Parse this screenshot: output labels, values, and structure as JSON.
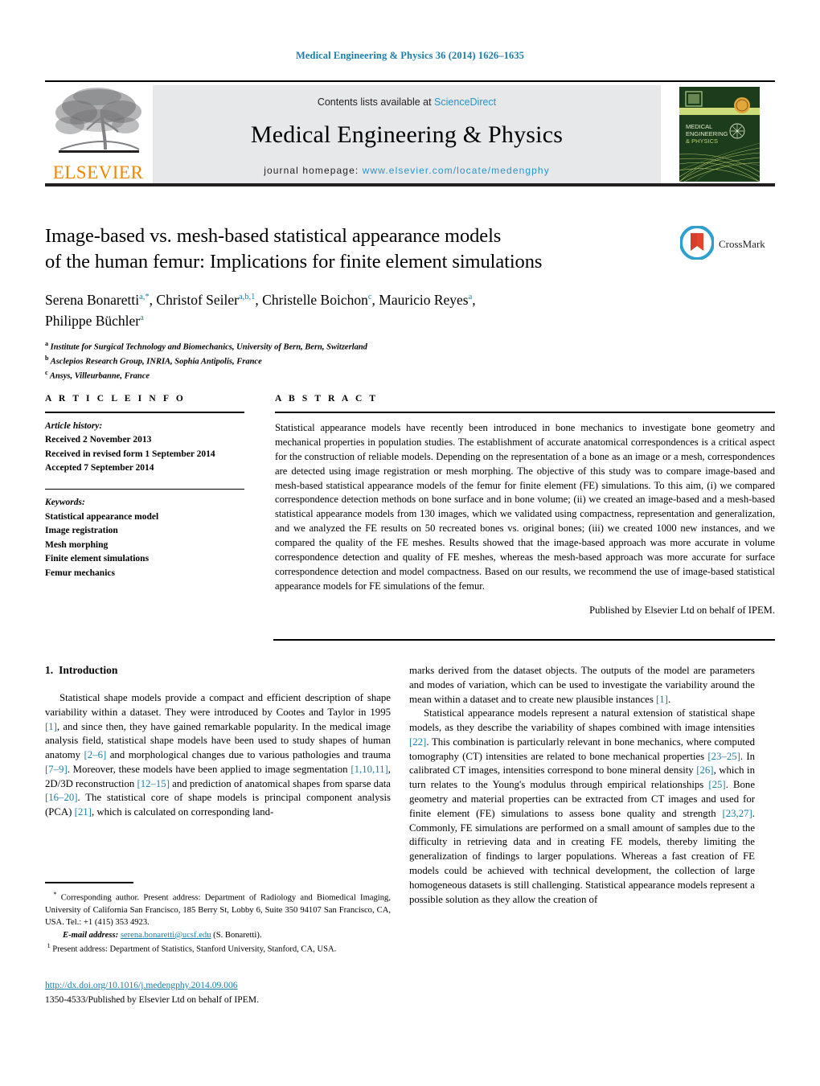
{
  "running_head": "Medical Engineering & Physics 36 (2014) 1626–1635",
  "masthead": {
    "contents_prefix": "Contents lists available at ",
    "sciencedirect": "ScienceDirect",
    "journal_title": "Medical Engineering & Physics",
    "homepage_prefix": "journal homepage: ",
    "homepage_url": "www.elsevier.com/locate/medengphy",
    "publisher_wordmark": "ELSEVIER",
    "cover_title_lines": [
      "MEDICAL",
      "ENGINEERING",
      "& PHYSICS"
    ],
    "accent_blue": "#2a93c9",
    "elsevier_orange": "#f08500",
    "band_gray": "#e7e8ea"
  },
  "crossmark": {
    "label": "CrossMark"
  },
  "article": {
    "title_line1": "Image-based vs. mesh-based statistical appearance models",
    "title_line2": "of the human femur: Implications for finite element simulations",
    "authors_line1_parts": [
      {
        "name": "Serena Bonaretti",
        "sup": "a,*"
      },
      {
        "name": "Christof Seiler",
        "sup": "a,b,1"
      },
      {
        "name": "Christelle Boichon",
        "sup": "c"
      },
      {
        "name": "Mauricio Reyes",
        "sup": "a"
      }
    ],
    "authors_line2_parts": [
      {
        "name": "Philippe Büchler",
        "sup": "a"
      }
    ],
    "affiliations": [
      {
        "mark": "a",
        "text": "Institute for Surgical Technology and Biomechanics, University of Bern, Bern, Switzerland"
      },
      {
        "mark": "b",
        "text": "Asclepios Research Group, INRIA, Sophia Antipolis, France"
      },
      {
        "mark": "c",
        "text": "Ansys, Villeurbanne, France"
      }
    ]
  },
  "article_info": {
    "heading": "A R T I C L E   I N F O",
    "history_label": "Article history:",
    "history": [
      "Received 2 November 2013",
      "Received in revised form 1 September 2014",
      "Accepted 7 September 2014"
    ],
    "keywords_label": "Keywords:",
    "keywords": [
      "Statistical appearance model",
      "Image registration",
      "Mesh morphing",
      "Finite element simulations",
      "Femur mechanics"
    ]
  },
  "abstract": {
    "heading": "A B S T R A C T",
    "body": "Statistical appearance models have recently been introduced in bone mechanics to investigate bone geometry and mechanical properties in population studies. The establishment of accurate anatomical correspondences is a critical aspect for the construction of reliable models. Depending on the representation of a bone as an image or a mesh, correspondences are detected using image registration or mesh morphing. The objective of this study was to compare image-based and mesh-based statistical appearance models of the femur for finite element (FE) simulations. To this aim, (i) we compared correspondence detection methods on bone surface and in bone volume; (ii) we created an image-based and a mesh-based statistical appearance models from 130 images, which we validated using compactness, representation and generalization, and we analyzed the FE results on 50 recreated bones vs. original bones; (iii) we created 1000 new instances, and we compared the quality of the FE meshes. Results showed that the image-based approach was more accurate in volume correspondence detection and quality of FE meshes, whereas the mesh-based approach was more accurate for surface correspondence detection and model compactness. Based on our results, we recommend the use of image-based statistical appearance models for FE simulations of the femur.",
    "copyright": "Published by Elsevier Ltd on behalf of IPEM."
  },
  "body": {
    "section1_number": "1.",
    "section1_title": "Introduction",
    "left_para1_a": "Statistical shape models provide a compact and efficient description of shape variability within a dataset. They were introduced by Cootes and Taylor in 1995 ",
    "left_para1_ref1": "[1]",
    "left_para1_b": ", and since then, they have gained remarkable popularity. In the medical image analysis field, statistical shape models have been used to study shapes of human anatomy ",
    "left_para1_ref2": "[2–6]",
    "left_para1_c": " and morphological changes due to various pathologies and trauma ",
    "left_para1_ref3": "[7–9]",
    "left_para1_d": ". Moreover, these models have been applied to image segmentation ",
    "left_para1_ref4": "[1,10,11]",
    "left_para1_e": ", 2D/3D reconstruction ",
    "left_para1_ref5": "[12–15]",
    "left_para1_f": " and prediction of anatomical shapes from sparse data ",
    "left_para1_ref6": "[16–20]",
    "left_para1_g": ". The statistical core of shape models is principal component analysis (PCA) ",
    "left_para1_ref7": "[21]",
    "left_para1_h": ", which is calculated on corresponding land-",
    "right_para1_a": "marks derived from the dataset objects. The outputs of the model are parameters and modes of variation, which can be used to investigate the variability around the mean within a dataset and to create new plausible instances ",
    "right_para1_ref1": "[1]",
    "right_para1_b": ".",
    "right_para2_a": "Statistical appearance models represent a natural extension of statistical shape models, as they describe the variability of shapes combined with image intensities ",
    "right_para2_ref1": "[22]",
    "right_para2_b": ". This combination is particularly relevant in bone mechanics, where computed tomography (CT) intensities are related to bone mechanical properties ",
    "right_para2_ref2": "[23–25]",
    "right_para2_c": ". In calibrated CT images, intensities correspond to bone mineral density ",
    "right_para2_ref3": "[26]",
    "right_para2_d": ", which in turn relates to the Young's modulus through empirical relationships ",
    "right_para2_ref4": "[25]",
    "right_para2_e": ". Bone geometry and material properties can be extracted from CT images and used for finite element (FE) simulations to assess bone quality and strength ",
    "right_para2_ref5": "[23,27]",
    "right_para2_f": ". Commonly, FE simulations are performed on a small amount of samples due to the difficulty in retrieving data and in creating FE models, thereby limiting the generalization of findings to larger populations. Whereas a fast creation of FE models could be achieved with technical development, the collection of large homogeneous datasets is still challenging. Statistical appearance models represent a possible solution as they allow the creation of"
  },
  "footnotes": {
    "corresponding_mark": "*",
    "corresponding_text": " Corresponding author. Present address: Department of Radiology and Biomedical Imaging, University of California San Francisco, 185 Berry St, Lobby 6, Suite 350 94107 San Francisco, CA, USA. Tel.: +1 (415) 353 4923.",
    "email_label": "E-mail address:",
    "email_address": "serena.bonaretti@ucsf.edu",
    "email_suffix": " (S. Bonaretti).",
    "present_address_mark": "1",
    "present_address_text": " Present address: Department of Statistics, Stanford University, Stanford, CA, USA."
  },
  "footer": {
    "doi_url": "http://dx.doi.org/10.1016/j.medengphy.2014.09.006",
    "issn_line": "1350-4533/Published by Elsevier Ltd on behalf of IPEM."
  }
}
